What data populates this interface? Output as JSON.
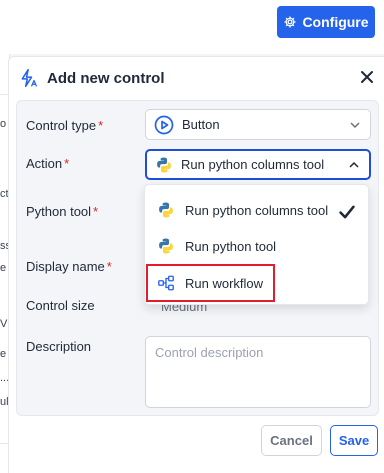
{
  "header": {
    "configure_label": "Configure"
  },
  "background": {
    "fragments": [
      "o",
      "ct",
      "ss",
      "e",
      "V",
      "e",
      "...",
      "ul"
    ]
  },
  "panel": {
    "title": "Add new control",
    "fields": {
      "control_type": {
        "label": "Control type",
        "value": "Button"
      },
      "action": {
        "label": "Action",
        "value": "Run python columns tool"
      },
      "python_tool": {
        "label": "Python tool"
      },
      "display_name": {
        "label": "Display name"
      },
      "control_size": {
        "label": "Control size",
        "value": "Medium"
      },
      "description": {
        "label": "Description",
        "placeholder": "Control description"
      }
    },
    "required_mark": "*",
    "dropdown": {
      "options": [
        {
          "label": "Run python columns tool",
          "icon": "python-icon",
          "selected": true
        },
        {
          "label": "Run python tool",
          "icon": "python-icon",
          "selected": false
        },
        {
          "label": "Run workflow",
          "icon": "workflow-icon",
          "selected": false,
          "highlighted": true
        }
      ]
    },
    "footer": {
      "cancel_label": "Cancel",
      "save_label": "Save"
    }
  },
  "colors": {
    "primary": "#2563eb",
    "required": "#dc2626",
    "highlight": "#e11d2e"
  }
}
